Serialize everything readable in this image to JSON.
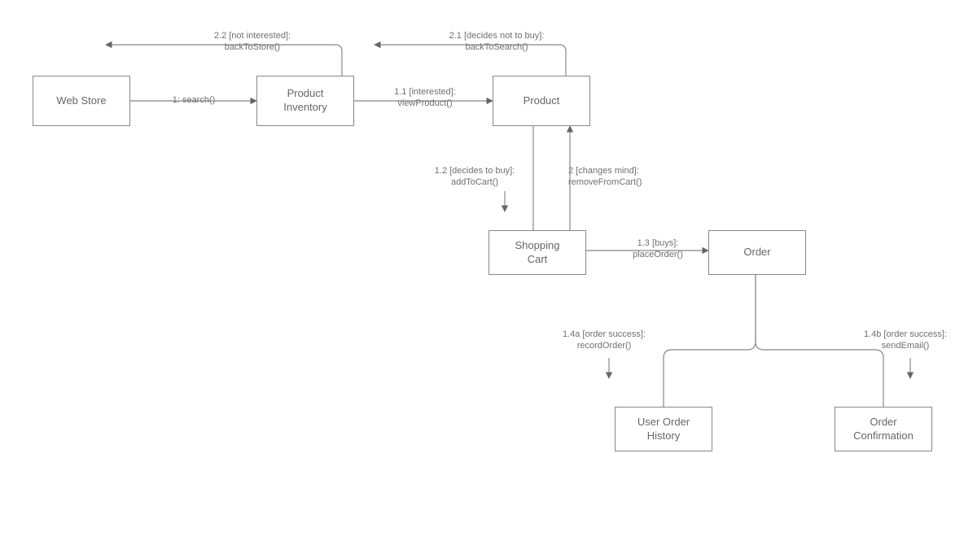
{
  "nodes": {
    "web_store": "Web Store",
    "product_inventory": "Product\nInventory",
    "product": "Product",
    "shopping_cart": "Shopping\nCart",
    "order": "Order",
    "user_order_history": "User Order\nHistory",
    "order_confirmation": "Order\nConfirmation"
  },
  "edges": {
    "search": "1: search()",
    "view_product": "1.1 [interested]:\nviewProduct()",
    "add_to_cart": "1.2 [decides to buy]:\naddToCart()",
    "remove_from_cart": "2 [changes mind]:\nremoveFromCart()",
    "place_order": "1.3 [buys]:\nplaceOrder()",
    "record_order": "1.4a [order success]:\nrecordOrder()",
    "send_email": "1.4b [order success]:\nsendEmail()",
    "back_to_search": "2.1 [decides not to buy]:\nbackToSearch()",
    "back_to_store": "2.2 [not interested]:\nbackToStore()"
  }
}
